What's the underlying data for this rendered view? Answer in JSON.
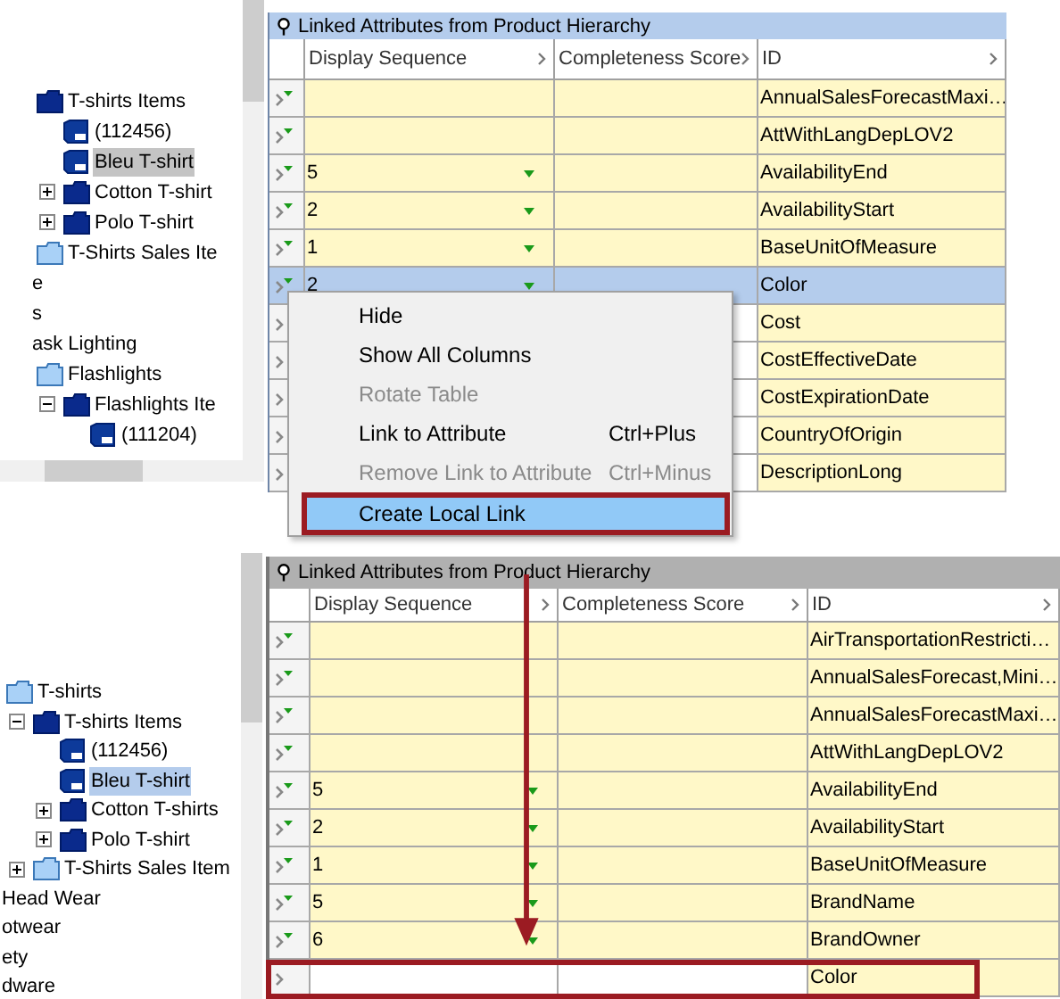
{
  "panels": [
    {
      "tree": {
        "items": [
          {
            "label": "T-shirts Items",
            "kind": "folder-dark",
            "selected": false,
            "children": [
              {
                "label": "(112456)",
                "kind": "item",
                "selected": false
              },
              {
                "label": "Bleu T-shirt",
                "kind": "item",
                "selected": true
              },
              {
                "label": "Cotton T-shirt",
                "kind": "folder-dark",
                "expanded": false,
                "selected": false
              },
              {
                "label": "Polo T-shirt",
                "kind": "folder-dark",
                "expanded": false,
                "selected": false
              }
            ]
          },
          {
            "label": "T-Shirts Sales Ite",
            "kind": "folder-light",
            "selected": false
          },
          {
            "label": "e",
            "selected": false
          },
          {
            "label": "s",
            "selected": false
          },
          {
            "label": "ask Lighting",
            "selected": false
          },
          {
            "label": "Flashlights",
            "kind": "folder-light",
            "selected": false,
            "children": [
              {
                "label": "Flashlights Ite",
                "kind": "folder-dark",
                "expanded": true,
                "selected": false,
                "children": [
                  {
                    "label": "(111204)",
                    "kind": "item",
                    "selected": false
                  }
                ]
              }
            ]
          }
        ]
      },
      "table": {
        "active": true,
        "title": "Linked Attributes from Product Hierarchy",
        "columns": [
          "Display Sequence",
          "Completeness Score",
          "ID"
        ],
        "rows": [
          {
            "linked": true,
            "selected": false,
            "outlined": false,
            "id": "AnnualSalesForecastMaxi…"
          },
          {
            "linked": true,
            "selected": false,
            "outlined": false,
            "id": "AttWithLangDepLOV2"
          },
          {
            "linked": true,
            "selected": false,
            "outlined": false,
            "sequence": "5",
            "id": "AvailabilityEnd"
          },
          {
            "linked": true,
            "selected": false,
            "outlined": false,
            "sequence": "2",
            "id": "AvailabilityStart"
          },
          {
            "linked": true,
            "selected": false,
            "outlined": false,
            "sequence": "1",
            "id": "BaseUnitOfMeasure"
          },
          {
            "linked": true,
            "selected": true,
            "outlined": false,
            "sequence": "2",
            "id": "Color"
          },
          {
            "selected": false,
            "outlined": false,
            "id": "Cost"
          },
          {
            "selected": false,
            "outlined": false,
            "id": "CostEffectiveDate"
          },
          {
            "selected": false,
            "outlined": false,
            "id": "CostExpirationDate"
          },
          {
            "selected": false,
            "outlined": false,
            "id": "CountryOfOrigin"
          },
          {
            "selected": false,
            "outlined": false,
            "id": "DescriptionLong"
          }
        ]
      },
      "context_menu": {
        "items": [
          {
            "label": "Hide",
            "disabled": false,
            "selected": false,
            "outlined": false
          },
          {
            "label": "Show All Columns",
            "disabled": false,
            "selected": false,
            "outlined": false
          },
          {
            "label": "Rotate Table",
            "disabled": true,
            "selected": false,
            "outlined": false
          },
          {
            "label": "Link to Attribute",
            "shortcut": "Ctrl+Plus",
            "disabled": false,
            "selected": false,
            "outlined": false
          },
          {
            "label": "Remove Link to Attribute",
            "shortcut": "Ctrl+Minus",
            "disabled": true,
            "selected": false,
            "outlined": false
          },
          {
            "label": "Create Local Link",
            "disabled": false,
            "selected": true,
            "outlined": true
          }
        ]
      }
    },
    {
      "tree": {
        "items": [
          {
            "label": "T-shirts",
            "kind": "folder-light",
            "selected": false,
            "children": [
              {
                "label": "T-shirts Items",
                "kind": "folder-dark",
                "expanded": true,
                "selected": false,
                "children": [
                  {
                    "label": "(112456)",
                    "kind": "item",
                    "selected": false
                  },
                  {
                    "label": "Bleu T-shirt",
                    "kind": "item",
                    "selected": true
                  },
                  {
                    "label": "Cotton T-shirts",
                    "kind": "folder-dark",
                    "expanded": false,
                    "selected": false
                  },
                  {
                    "label": "Polo T-shirt",
                    "kind": "folder-dark",
                    "expanded": false,
                    "selected": false
                  }
                ]
              },
              {
                "label": "T-Shirts Sales Item",
                "kind": "folder-light",
                "expanded": false,
                "selected": false
              }
            ]
          },
          {
            "label": "Head Wear",
            "selected": false
          },
          {
            "label": "otwear",
            "selected": false
          },
          {
            "label": "ety",
            "selected": false
          },
          {
            "label": "dware",
            "selected": false
          }
        ]
      },
      "table": {
        "active": false,
        "title": "Linked Attributes from Product Hierarchy",
        "columns": [
          "Display Sequence",
          "Completeness Score",
          "ID"
        ],
        "rows": [
          {
            "linked": true,
            "selected": false,
            "outlined": false,
            "id": "AirTransportationRestricti…"
          },
          {
            "linked": true,
            "selected": false,
            "outlined": false,
            "id": "AnnualSalesForecast,Mini…"
          },
          {
            "linked": true,
            "selected": false,
            "outlined": false,
            "id": "AnnualSalesForecastMaxi…"
          },
          {
            "linked": true,
            "selected": false,
            "outlined": false,
            "id": "AttWithLangDepLOV2"
          },
          {
            "linked": true,
            "selected": false,
            "outlined": false,
            "sequence": "5",
            "id": "AvailabilityEnd"
          },
          {
            "linked": true,
            "selected": false,
            "outlined": false,
            "sequence": "2",
            "id": "AvailabilityStart"
          },
          {
            "linked": true,
            "selected": false,
            "outlined": false,
            "sequence": "1",
            "id": "BaseUnitOfMeasure"
          },
          {
            "linked": true,
            "selected": false,
            "outlined": false,
            "sequence": "5",
            "id": "BrandName"
          },
          {
            "linked": true,
            "selected": false,
            "outlined": false,
            "sequence": "6",
            "id": "BrandOwner"
          },
          {
            "linked": false,
            "selected": false,
            "outlined": true,
            "id": "Color"
          }
        ]
      }
    }
  ]
}
